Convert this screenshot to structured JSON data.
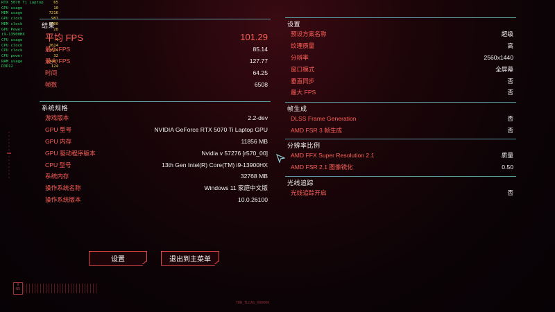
{
  "osd": [
    {
      "label": "RTX 5070 Ti Laptop",
      "value": "65"
    },
    {
      "label": "GPU usage",
      "value": "10"
    },
    {
      "label": "MEM usage",
      "value": "7216"
    },
    {
      "label": "GPU clock",
      "value": "987"
    },
    {
      "label": "MEM clock",
      "value": "1500"
    },
    {
      "label": "GPU Power",
      "value": "28"
    },
    {
      "label": "i9-13900HX",
      "value": ""
    },
    {
      "label": "CPU usage",
      "value": "4"
    },
    {
      "label": "CPU clock",
      "value": "2614"
    },
    {
      "label": "CPU clock",
      "value": "2614"
    },
    {
      "label": "CPU power",
      "value": "32"
    },
    {
      "label": "RAM usage",
      "value": "13407"
    },
    {
      "label": "D3D12",
      "value": "124"
    }
  ],
  "summary": {
    "heading": "结果",
    "avg_fps_label": "平均 FPS",
    "avg_fps_value": "101.29",
    "rows": [
      {
        "label": "最小 FPS",
        "value": "85.14"
      },
      {
        "label": "最大 FPS",
        "value": "127.77"
      },
      {
        "label": "时间",
        "value": "64.25"
      },
      {
        "label": "帧数",
        "value": "6508"
      }
    ]
  },
  "system": {
    "heading": "系统规格",
    "rows": [
      {
        "label": "游戏版本",
        "value": "2.2-dev"
      },
      {
        "label": "GPU 型号",
        "value": "NVIDIA GeForce RTX 5070 Ti Laptop GPU"
      },
      {
        "label": "GPU 内存",
        "value": "11856 MB"
      },
      {
        "label": "GPU 驱动程序版本",
        "value": "Nvidia v 57276 [r570_00]"
      },
      {
        "label": "CPU 型号",
        "value": "13th Gen Intel(R) Core(TM) i9-13900HX"
      },
      {
        "label": "系统内存",
        "value": "32768 MB"
      },
      {
        "label": "操作系统名称",
        "value": "Windows 11 家庭中文版"
      },
      {
        "label": "操作系统版本",
        "value": "10.0.26100"
      }
    ]
  },
  "settings": {
    "heading": "设置",
    "rows": [
      {
        "label": "预设方案名称",
        "value": "超级"
      },
      {
        "label": "纹理质量",
        "value": "高"
      },
      {
        "label": "分辨率",
        "value": "2560x1440"
      },
      {
        "label": "窗口模式",
        "value": "全屏幕"
      },
      {
        "label": "垂直同步",
        "value": "否"
      },
      {
        "label": "最大 FPS",
        "value": "否"
      }
    ]
  },
  "frame_gen": {
    "heading": "帧生成",
    "rows": [
      {
        "label": "DLSS Frame Generation",
        "value": "否"
      },
      {
        "label": "AMD FSR 3 帧生成",
        "value": "否"
      }
    ]
  },
  "resolution_scale": {
    "heading": "分辨率比例",
    "rows": [
      {
        "label": "AMD FFX Super Resolution 2.1",
        "value": "质量"
      },
      {
        "label": "AMD FSR 2.1 图像锐化",
        "value": "0.50"
      }
    ]
  },
  "ray_tracing": {
    "heading": "光线追踪",
    "rows": [
      {
        "label": "光线追踪开启",
        "value": "否"
      }
    ]
  },
  "buttons": {
    "settings": "设置",
    "exit": "退出到主菜单"
  },
  "badge": "V\n85",
  "footer_code": "TRN_TLCAS_000000",
  "colors": {
    "accent": "#ff5f57",
    "rule": "#5a9aa0",
    "button_border": "#e0484b"
  }
}
